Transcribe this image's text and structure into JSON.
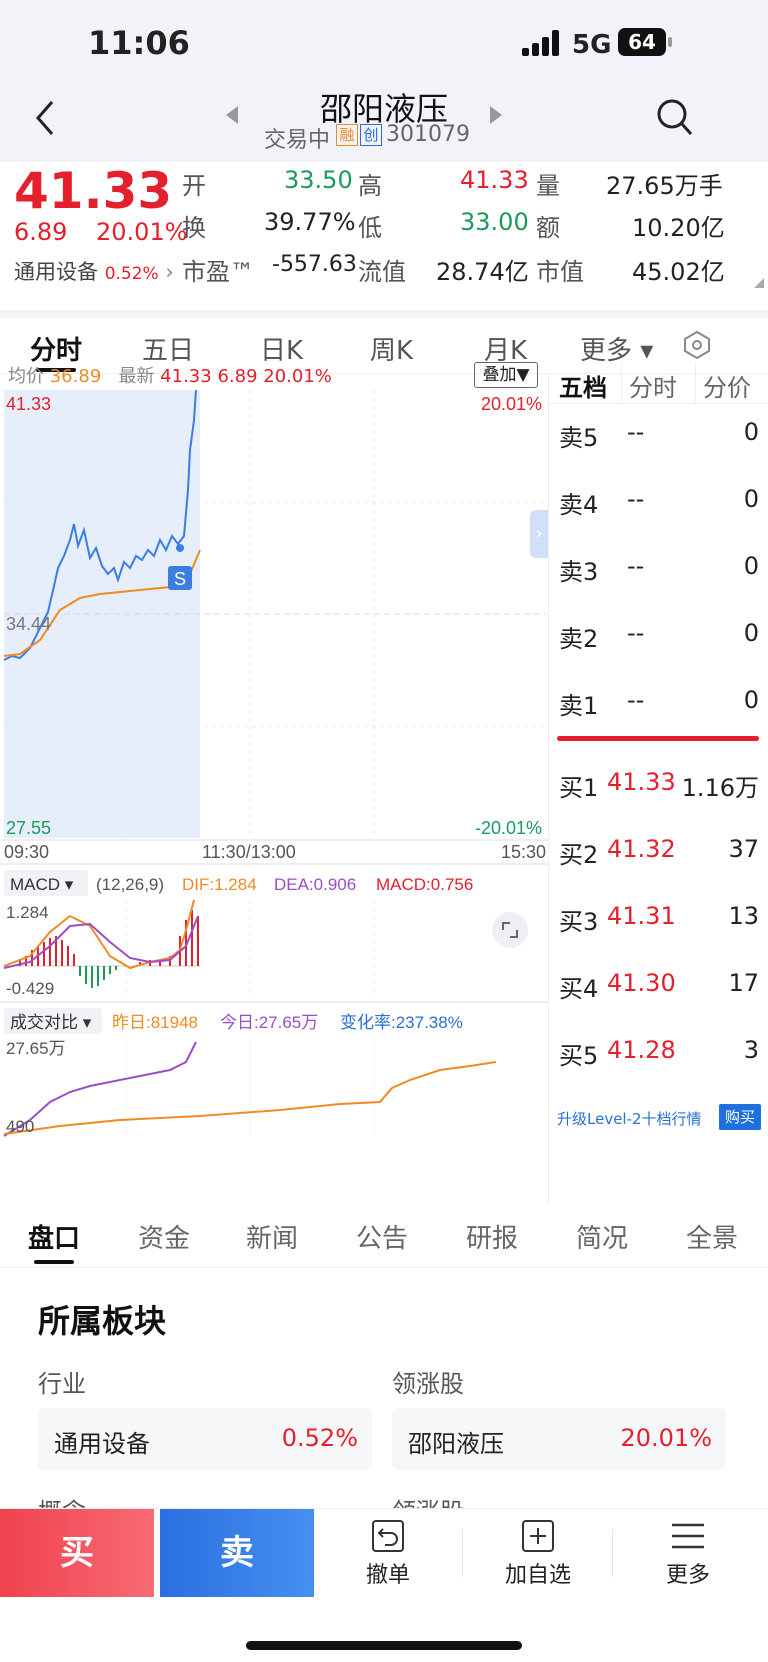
{
  "status": {
    "time": "11:06",
    "network": "5G",
    "battery": "64"
  },
  "header": {
    "title": "邵阳液压",
    "status": "交易中",
    "tag_rong": "融",
    "tag_chuang": "创",
    "code": "301079"
  },
  "quote": {
    "price": "41.33",
    "change": "6.89",
    "change_pct": "20.01%",
    "sector_name": "通用设备",
    "sector_pct": "0.52%",
    "labels": {
      "open": "开",
      "high": "高",
      "vol": "量",
      "turnover": "换",
      "low": "低",
      "amount": "额",
      "pe": "市盈™",
      "float_mv": "流值",
      "mv": "市值"
    },
    "open": "33.50",
    "high": "41.33",
    "vol": "27.65万手",
    "turnover": "39.77%",
    "low": "33.00",
    "amount": "10.20亿",
    "pe": "-557.63",
    "float_mv": "28.74亿",
    "mv": "45.02亿"
  },
  "tabs": [
    "分时",
    "五日",
    "日K",
    "周K",
    "月K",
    "更多 ▾"
  ],
  "chart": {
    "avg_label": "均价",
    "avg_value": "36.89",
    "last_label": "最新",
    "last_value": "41.33",
    "last_change": "6.89",
    "last_pct": "20.01%",
    "overlay_btn": "叠加▼",
    "y_top": "41.33",
    "y_mid": "34.44",
    "y_bottom": "27.55",
    "pct_top": "20.01%",
    "pct_bottom": "-20.01%",
    "x_start": "09:30",
    "x_mid": "11:30/13:00",
    "x_end": "15:30",
    "marker": "S",
    "macd_label": "MACD ▾",
    "macd_params": "(12,26,9)",
    "dif": "DIF:1.284",
    "dea": "DEA:0.906",
    "macd": "MACD:0.756",
    "macd_top": "1.284",
    "macd_bottom": "-0.429",
    "vol_label": "成交对比 ▾",
    "vol_yest": "昨日:81948",
    "vol_today": "今日:27.65万",
    "vol_rate": "变化率:237.38%",
    "vol_top": "27.65万",
    "vol_bottom": "490"
  },
  "orderbook": {
    "tabs": [
      "五档",
      "分时",
      "分价"
    ],
    "sells": [
      {
        "label": "卖5",
        "price": "--",
        "qty": "0"
      },
      {
        "label": "卖4",
        "price": "--",
        "qty": "0"
      },
      {
        "label": "卖3",
        "price": "--",
        "qty": "0"
      },
      {
        "label": "卖2",
        "price": "--",
        "qty": "0"
      },
      {
        "label": "卖1",
        "price": "--",
        "qty": "0"
      }
    ],
    "buys": [
      {
        "label": "买1",
        "price": "41.33",
        "qty": "1.16万"
      },
      {
        "label": "买2",
        "price": "41.32",
        "qty": "37"
      },
      {
        "label": "买3",
        "price": "41.31",
        "qty": "13"
      },
      {
        "label": "买4",
        "price": "41.30",
        "qty": "17"
      },
      {
        "label": "买5",
        "price": "41.28",
        "qty": "3"
      }
    ],
    "upgrade": "升级Level-2十档行情",
    "buy_btn": "购买"
  },
  "subtabs": [
    "盘口",
    "资金",
    "新闻",
    "公告",
    "研报",
    "简况",
    "全景"
  ],
  "sector": {
    "title": "所属板块",
    "industry_label": "行业",
    "leader_label": "领涨股",
    "industry_name": "通用设备",
    "industry_pct": "0.52%",
    "leader_name": "邵阳液压",
    "leader_pct": "20.01%",
    "concept_label": "概念",
    "leader_label2": "领涨股"
  },
  "bottom": {
    "buy": "买",
    "sell": "卖",
    "cancel": "撤单",
    "watch": "加自选",
    "more": "更多"
  },
  "colors": {
    "red": "#e3202b",
    "green": "#1a9b5c",
    "blue": "#2a6fd6",
    "orange": "#f08a24",
    "purple": "#9b4dc8"
  }
}
